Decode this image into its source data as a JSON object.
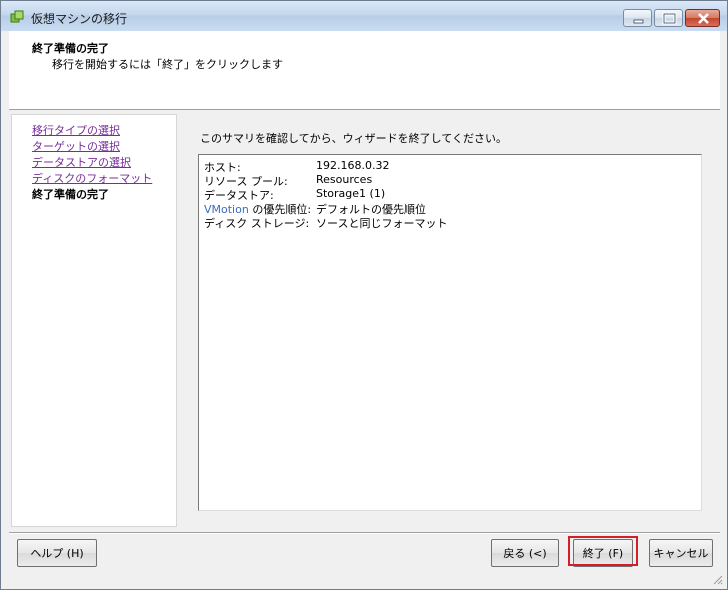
{
  "window": {
    "title": "仮想マシンの移行"
  },
  "header": {
    "title": "終了準備の完了",
    "subtitle": "移行を開始するには「終了」をクリックします"
  },
  "nav": {
    "items": [
      {
        "label": "移行タイプの選択",
        "current": false
      },
      {
        "label": "ターゲットの選択",
        "current": false
      },
      {
        "label": "データストアの選択",
        "current": false
      },
      {
        "label": "ディスクのフォーマット",
        "current": false
      },
      {
        "label": "終了準備の完了",
        "current": true
      }
    ]
  },
  "main": {
    "instruction": "このサマリを確認してから、ウィザードを終了してください。",
    "summary": [
      {
        "key": "ホスト:",
        "value": "192.168.0.32"
      },
      {
        "key": "リソース プール:",
        "value": "Resources"
      },
      {
        "key": "データストア:",
        "value": "Storage1 (1)"
      },
      {
        "key_prefix": "VMotion",
        "key": " の優先順位:",
        "value": "デフォルトの優先順位"
      },
      {
        "key": "ディスク ストレージ:",
        "value": "ソースと同じフォーマット"
      }
    ]
  },
  "footer": {
    "help_label": "ヘルプ (H)",
    "back_label": "戻る (<)",
    "finish_label": "終了 (F)",
    "cancel_label": "キャンセル"
  },
  "colors": {
    "link": "#7a2c9a",
    "highlight": "#d21f2a",
    "vmotion": "#3b6cc1"
  }
}
